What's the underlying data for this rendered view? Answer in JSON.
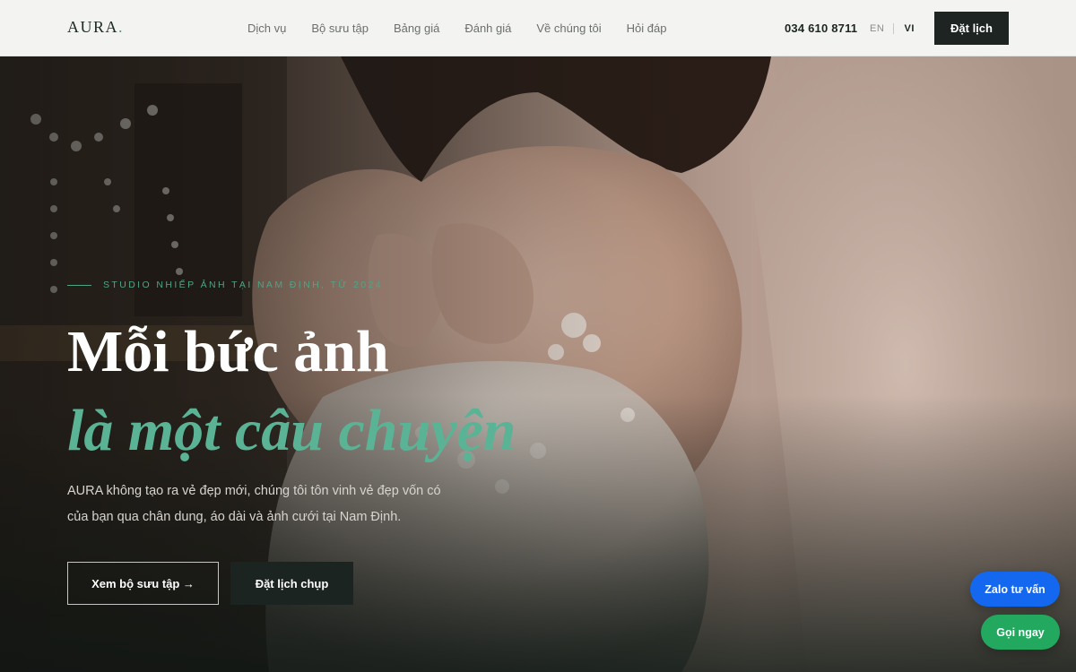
{
  "brand": {
    "name": "AURA",
    "dot": "."
  },
  "nav": {
    "items": [
      {
        "label": "Dịch vụ"
      },
      {
        "label": "Bộ sưu tập"
      },
      {
        "label": "Bảng giá"
      },
      {
        "label": "Đánh giá"
      },
      {
        "label": "Về chúng tôi"
      },
      {
        "label": "Hỏi đáp"
      }
    ]
  },
  "header": {
    "phone": "034 610 8711",
    "lang_en": "EN",
    "lang_vi": "VI",
    "book_label": "Đặt lịch"
  },
  "hero": {
    "eyebrow": "STUDIO NHIẾP ẢNH TẠI NAM ĐỊNH, TỪ 2024",
    "title_line1": "Mỗi bức ảnh",
    "title_line2": "là một câu chuyện",
    "description": "AURA không tạo ra vẻ đẹp mới, chúng tôi tôn vinh vẻ đẹp vốn có của bạn qua chân dung, áo dài và ảnh cưới tại Nam Định.",
    "btn_collection": "Xem bộ sưu tập →",
    "btn_book": "Đặt lịch chụp"
  },
  "floating": {
    "zalo_label": "Zalo tư vấn",
    "call_label": "Gọi ngay"
  },
  "colors": {
    "accent": "#4fa486",
    "dark": "#1d2422",
    "zalo": "#1468f0",
    "call": "#23a95f"
  }
}
